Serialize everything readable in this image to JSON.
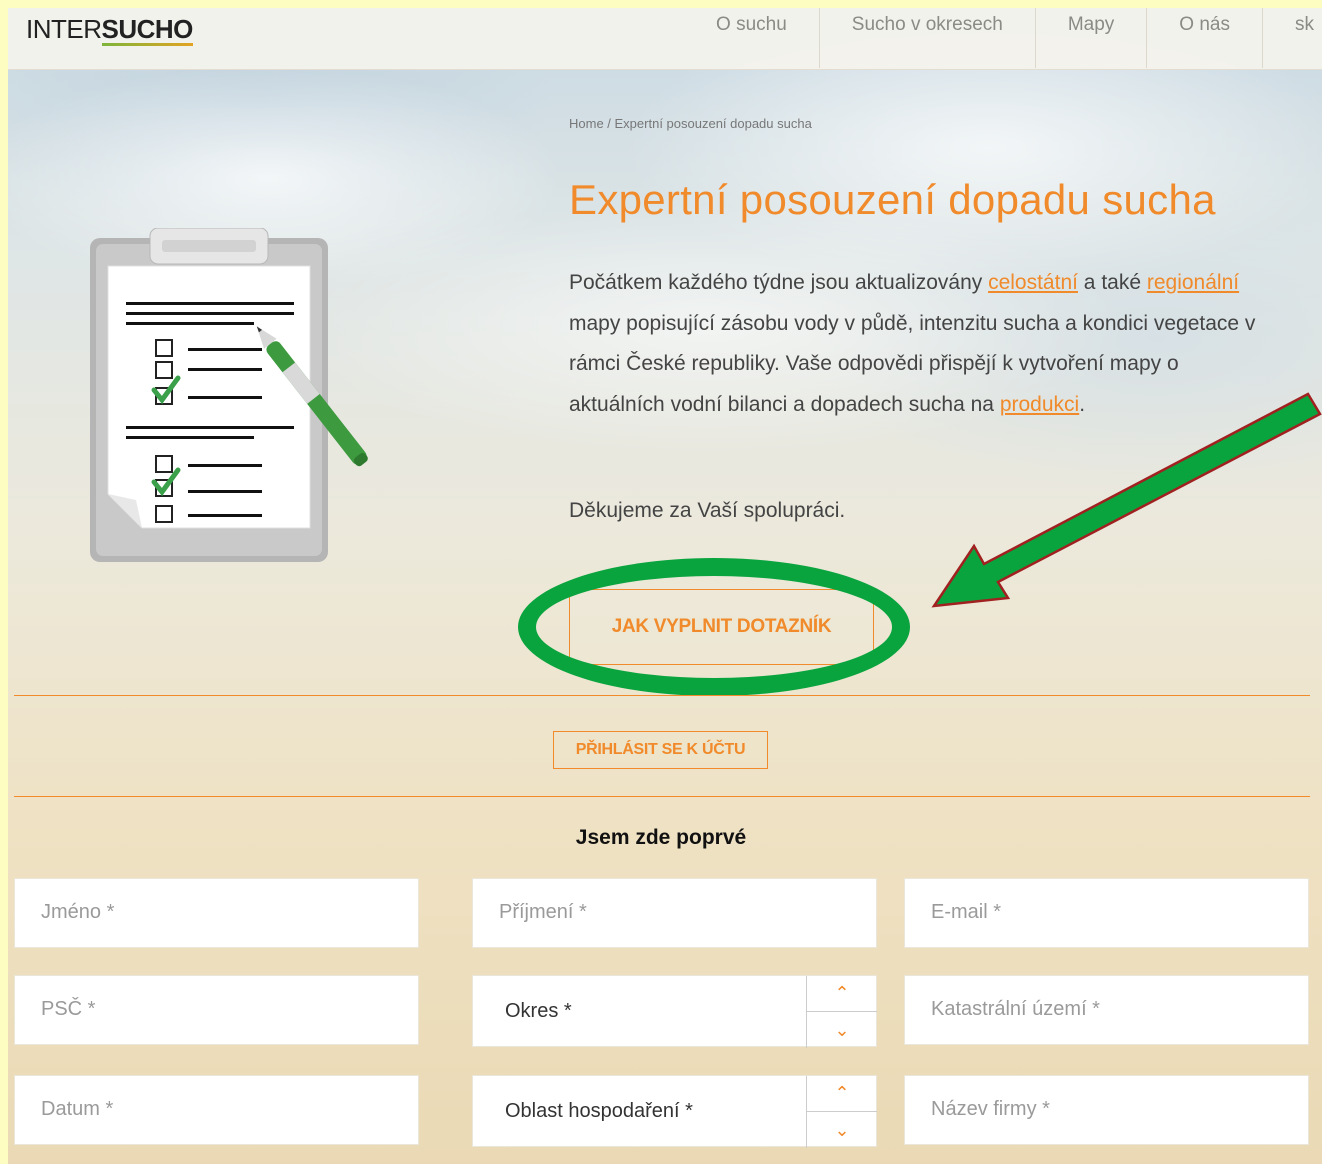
{
  "header": {
    "logo_plain": "INTER",
    "logo_bold": "SUCHO",
    "nav": [
      "O suchu",
      "Sucho v okresech",
      "Mapy",
      "O nás",
      "sk"
    ]
  },
  "breadcrumb": "Home / Expertní posouzení dopadu sucha",
  "page_title": "Expertní posouzení dopadu sucha",
  "intro": {
    "part1": "Počátkem každého týdne jsou aktualizovány ",
    "link1": "celostátní",
    "part2": " a také ",
    "link2": "regionální",
    "part3": " mapy popisující zásobu vody v půdě, intenzitu sucha a kondici vegetace v rámci České republiky. Vaše odpovědi přispějí k vytvoření mapy o aktuálních vodní bilanci a dopadech sucha na ",
    "link3": "produkci",
    "part4": "."
  },
  "thanks": "Děkujeme za Vaší spolupráci.",
  "how_button": "JAK VYPLNIT DOTAZNÍK",
  "login_button": "PŘIHLÁSIT SE K ÚČTU",
  "form": {
    "title": "Jsem zde poprvé",
    "first_name": "Jméno *",
    "last_name": "Příjmení *",
    "email": "E-mail *",
    "zip": "PSČ *",
    "district": "Okres *",
    "cadastral": "Katastrální území *",
    "date": "Datum *",
    "farming_area": "Oblast hospodaření *",
    "company": "Název firmy *"
  },
  "colors": {
    "accent": "#f08a2a",
    "highlight": "#0aa43f",
    "page_outer": "#fdfdc2"
  }
}
